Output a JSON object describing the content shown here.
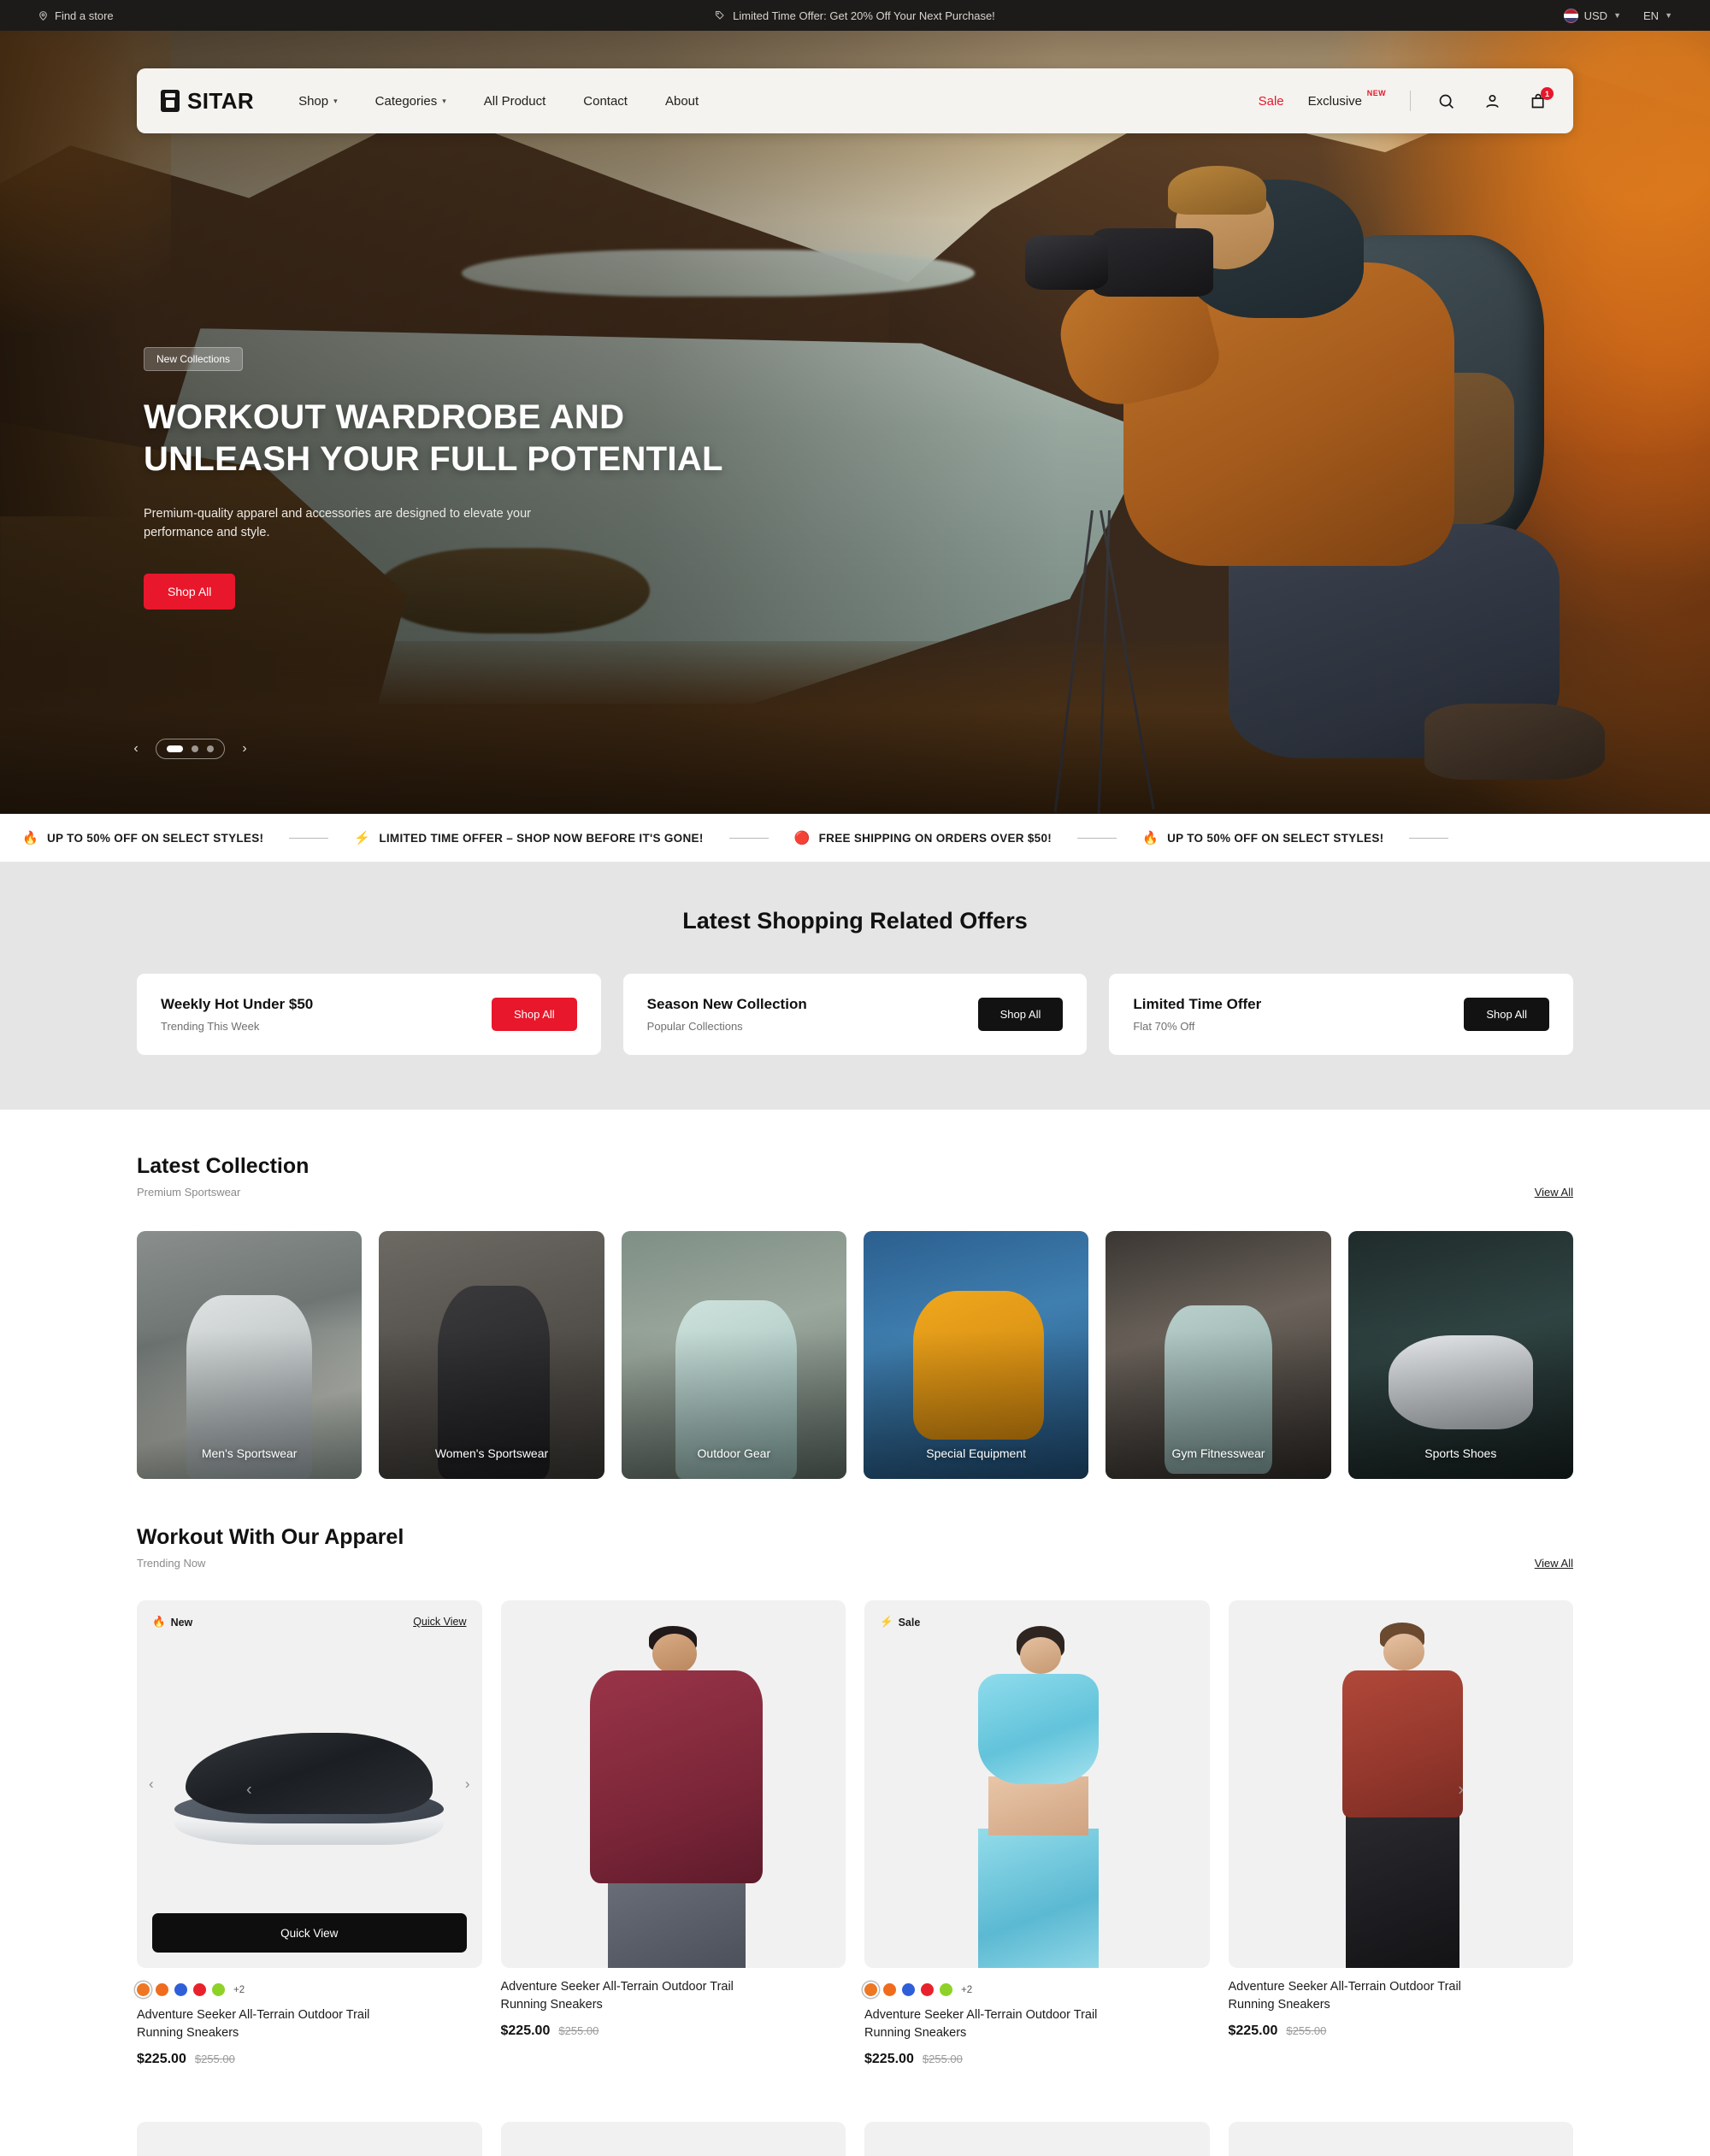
{
  "topbar": {
    "find_store": "Find a store",
    "promo": "Limited Time Offer: Get 20% Off Your Next Purchase!",
    "currency": "USD",
    "language": "EN"
  },
  "nav": {
    "brand": "SITAR",
    "links": [
      {
        "label": "Shop",
        "has_caret": true
      },
      {
        "label": "Categories",
        "has_caret": true
      },
      {
        "label": "All Product",
        "has_caret": false
      },
      {
        "label": "Contact",
        "has_caret": false
      },
      {
        "label": "About",
        "has_caret": false
      }
    ],
    "sale_label": "Sale",
    "exclusive_label": "Exclusive",
    "exclusive_badge": "NEW",
    "cart_count": "1",
    "accent_red": "#e8172b"
  },
  "hero": {
    "badge": "New Collections",
    "title_line1": "WORKOUT WARDROBE AND",
    "title_line2": "UNLEASH YOUR FULL POTENTIAL",
    "subtitle": "Premium-quality apparel and accessories are designed to elevate your performance and style.",
    "cta": "Shop All",
    "slide_count": 3,
    "active_slide": 1
  },
  "ticker": {
    "items": [
      {
        "icon": "fire",
        "text": "UP TO 50% OFF ON SELECT STYLES!"
      },
      {
        "icon": "bolt",
        "text": "LIMITED TIME OFFER – SHOP NOW BEFORE IT'S GONE!"
      },
      {
        "icon": "gem",
        "text": "FREE SHIPPING ON ORDERS OVER $50!"
      },
      {
        "icon": "fire",
        "text": "UP TO 50% OFF ON SELECT STYLES!"
      }
    ]
  },
  "offers": {
    "heading": "Latest Shopping Related Offers",
    "cards": [
      {
        "title": "Weekly Hot Under $50",
        "subtitle": "Trending This Week",
        "button": "Shop All",
        "style": "red"
      },
      {
        "title": "Season New Collection",
        "subtitle": "Popular Collections",
        "button": "Shop All",
        "style": "dark"
      },
      {
        "title": "Limited Time Offer",
        "subtitle": "Flat 70% Off",
        "button": "Shop All",
        "style": "dark"
      }
    ]
  },
  "collection": {
    "title": "Latest Collection",
    "subtitle": "Premium Sportswear",
    "view_all": "View All",
    "categories": [
      {
        "label": "Men's Sportswear"
      },
      {
        "label": "Women's Sportswear"
      },
      {
        "label": "Outdoor Gear"
      },
      {
        "label": "Special Equipment"
      },
      {
        "label": "Gym Fitnesswear"
      },
      {
        "label": "Sports Shoes"
      }
    ]
  },
  "apparel": {
    "title": "Workout With Our Apparel",
    "subtitle": "Trending Now",
    "view_all": "View All",
    "quick_view_link": "Quick View",
    "quick_view_button": "Quick View",
    "swatch_more": "+2",
    "swatch_colors": [
      "#ee7723",
      "#ef6c1f",
      "#2f5fd8",
      "#e8222c",
      "#8ed227"
    ],
    "products": [
      {
        "badge": "New",
        "badge_icon": "fire",
        "title": "Adventure Seeker All-Terrain Outdoor Trail Running Sneakers",
        "price": "$225.00",
        "compare_price": "$255.00",
        "has_swatches": true,
        "has_quick_view": true
      },
      {
        "badge": "",
        "badge_icon": "",
        "title": "Adventure Seeker All-Terrain Outdoor Trail Running Sneakers",
        "price": "$225.00",
        "compare_price": "$255.00",
        "has_swatches": false,
        "has_quick_view": false
      },
      {
        "badge": "Sale",
        "badge_icon": "bolt",
        "title": "Adventure Seeker All-Terrain Outdoor Trail Running Sneakers",
        "price": "$225.00",
        "compare_price": "$255.00",
        "has_swatches": true,
        "has_quick_view": false
      },
      {
        "badge": "",
        "badge_icon": "",
        "title": "Adventure Seeker All-Terrain Outdoor Trail Running Sneakers",
        "price": "$225.00",
        "compare_price": "$255.00",
        "has_swatches": false,
        "has_quick_view": false
      }
    ]
  }
}
